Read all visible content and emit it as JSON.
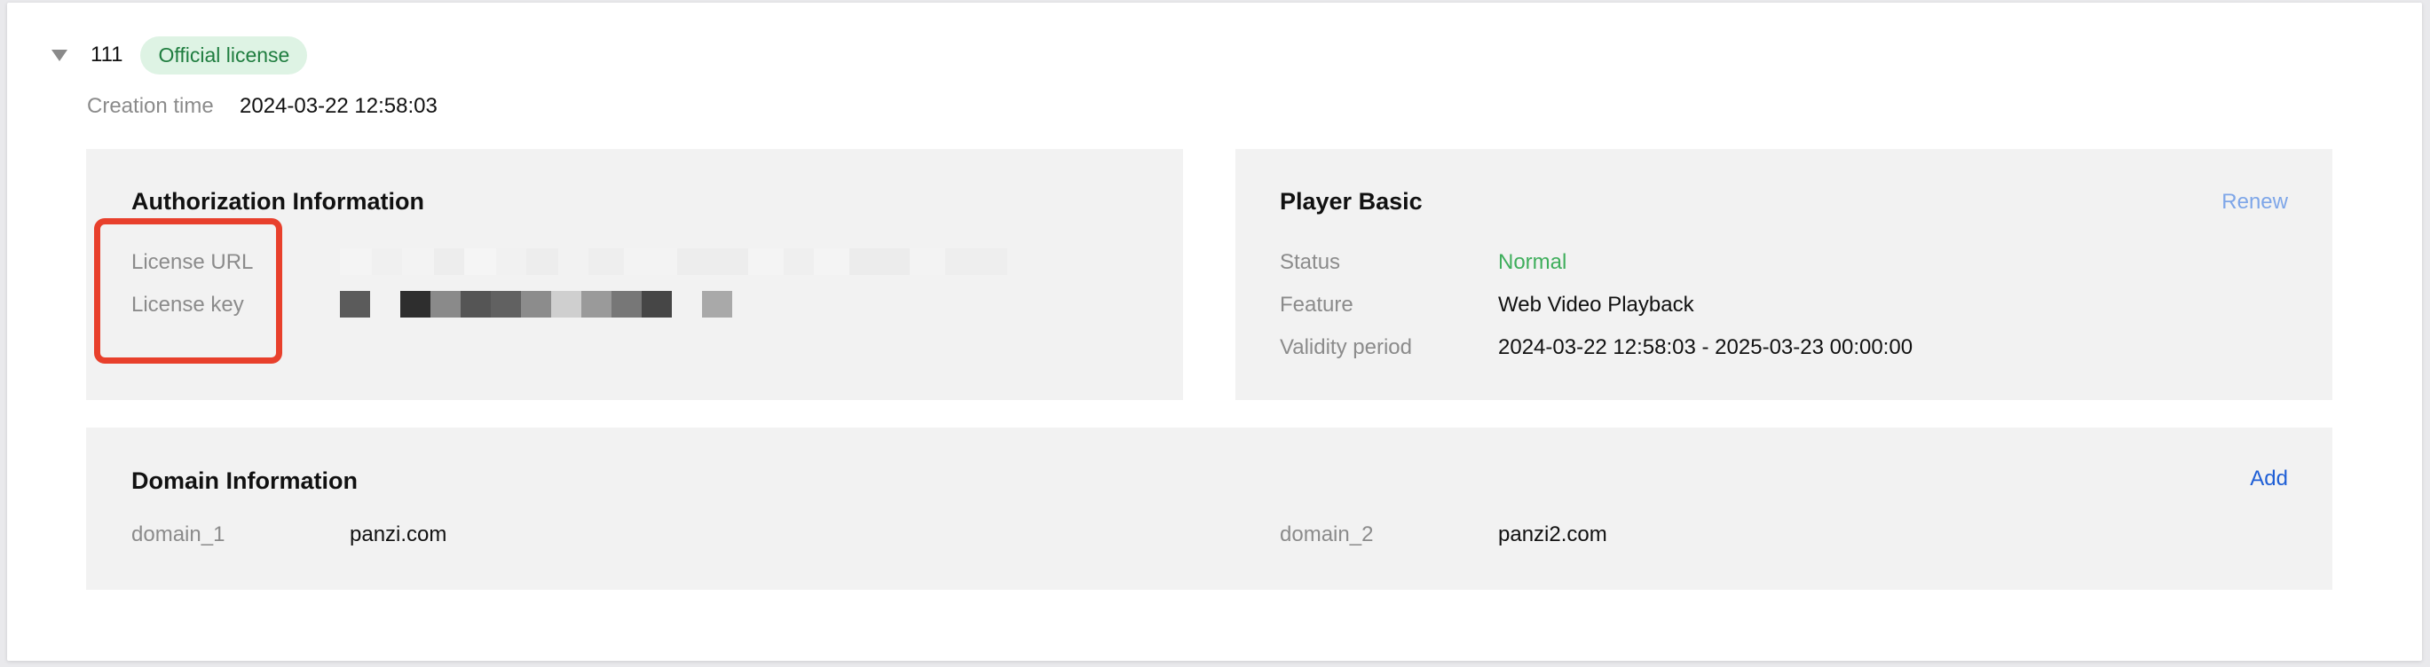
{
  "license": {
    "name": "111",
    "badge": "Official license",
    "creation_label": "Creation time",
    "creation_value": "2024-03-22 12:58:03"
  },
  "authorization": {
    "title": "Authorization Information",
    "url_label": "License URL",
    "key_label": "License key",
    "values_obscured": true
  },
  "player_basic": {
    "title": "Player Basic",
    "renew_label": "Renew",
    "status_label": "Status",
    "status_value": "Normal",
    "feature_label": "Feature",
    "feature_value": "Web Video Playback",
    "validity_label": "Validity period",
    "validity_value": "2024-03-22 12:58:03 - 2025-03-23 00:00:00"
  },
  "domain": {
    "title": "Domain Information",
    "add_label": "Add",
    "items": [
      {
        "label": "domain_1",
        "value": "panzi.com"
      },
      {
        "label": "domain_2",
        "value": "panzi2.com"
      }
    ]
  },
  "colors": {
    "status_normal": "#3fae5c",
    "renew_link": "#7ea6e8",
    "add_link": "#1f5fd6",
    "badge_bg": "#def3e4",
    "badge_text": "#1f7d3f",
    "highlight_box": "#e8402c"
  }
}
